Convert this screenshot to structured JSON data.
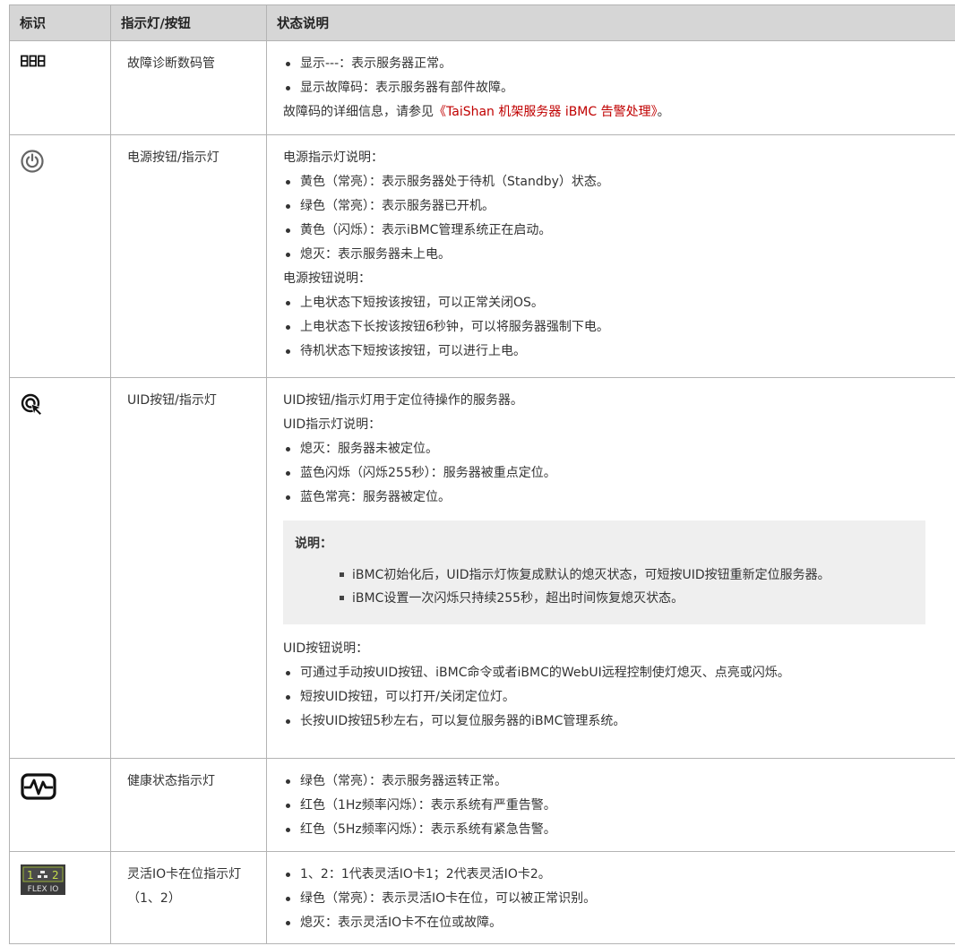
{
  "header": {
    "col1": "标识",
    "col2": "指示灯/按钮",
    "col3": "状态说明"
  },
  "rows": [
    {
      "icon": "seven-segment-display-icon",
      "name": "故障诊断数码管",
      "items": [
        "显示---：表示服务器正常。",
        "显示故障码：表示服务器有部件故障。"
      ],
      "link_prefix": "故障码的详细信息，请参见",
      "link_text": "《TaiShan 机架服务器 iBMC 告警处理》",
      "link_suffix": "。"
    },
    {
      "icon": "power-button-icon",
      "name": "电源按钮/指示灯",
      "led_title": "电源指示灯说明：",
      "led_items": [
        "黄色（常亮）：表示服务器处于待机（Standby）状态。",
        "绿色（常亮）：表示服务器已开机。",
        "黄色（闪烁）：表示iBMC管理系统正在启动。",
        "熄灭：表示服务器未上电。"
      ],
      "btn_title": "电源按钮说明：",
      "btn_items": [
        "上电状态下短按该按钮，可以正常关闭OS。",
        "上电状态下长按该按钮6秒钟，可以将服务器强制下电。",
        "待机状态下短按该按钮，可以进行上电。"
      ]
    },
    {
      "icon": "uid-locate-icon",
      "name": "UID按钮/指示灯",
      "intro": "UID按钮/指示灯用于定位待操作的服务器。",
      "led_title": "UID指示灯说明：",
      "led_items": [
        "熄灭：服务器未被定位。",
        "蓝色闪烁（闪烁255秒）：服务器被重点定位。",
        "蓝色常亮：服务器被定位。"
      ],
      "note_title": "说明：",
      "note_items": [
        "iBMC初始化后，UID指示灯恢复成默认的熄灭状态，可短按UID按钮重新定位服务器。",
        "iBMC设置一次闪烁只持续255秒，超出时间恢复熄灭状态。"
      ],
      "btn_title": "UID按钮说明：",
      "btn_items": [
        "可通过手动按UID按钮、iBMC命令或者iBMC的WebUI远程控制使灯熄灭、点亮或闪烁。",
        "短按UID按钮，可以打开/关闭定位灯。",
        "长按UID按钮5秒左右，可以复位服务器的iBMC管理系统。"
      ]
    },
    {
      "icon": "health-heartbeat-icon",
      "name": "健康状态指示灯",
      "items": [
        "绿色（常亮）：表示服务器运转正常。",
        "红色（1Hz频率闪烁）：表示系统有严重告警。",
        "红色（5Hz频率闪烁）：表示系统有紧急告警。"
      ]
    },
    {
      "icon": "flex-io-card-icon",
      "icon_text_1": "1",
      "icon_text_2": "2",
      "icon_text_3": "FLEX IO",
      "name": "灵活IO卡在位指示灯（1、2）",
      "items": [
        "1、2：1代表灵活IO卡1；2代表灵活IO卡2。",
        "绿色（常亮）：表示灵活IO卡在位，可以被正常识别。",
        "熄灭：表示灵活IO卡不在位或故障。"
      ]
    }
  ]
}
